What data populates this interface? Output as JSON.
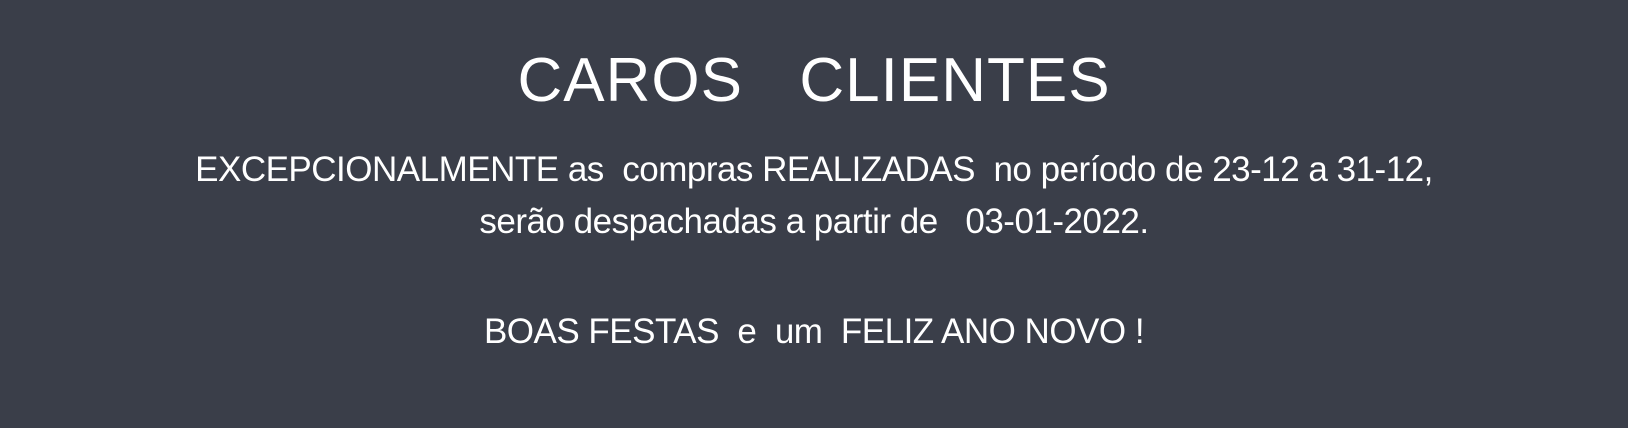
{
  "banner": {
    "title": "CAROS  CLIENTES",
    "message_line_1": "EXCEPCIONALMENTE as  compras REALIZADAS  no período de 23-12 a 31-12,",
    "message_line_2": "serão despachadas a partir de   03-01-2022.",
    "greeting": "BOAS FESTAS  e  um  FELIZ ANO NOVO !"
  },
  "colors": {
    "background": "#3a3e49",
    "text": "#ffffff"
  }
}
